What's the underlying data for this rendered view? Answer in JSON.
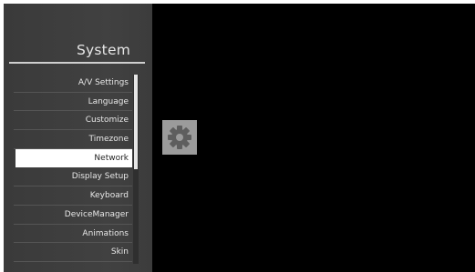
{
  "sidebar": {
    "title": "System",
    "items": [
      {
        "label": "A/V Settings"
      },
      {
        "label": "Language"
      },
      {
        "label": "Customize"
      },
      {
        "label": "Timezone"
      },
      {
        "label": "Network"
      },
      {
        "label": "Display Setup"
      },
      {
        "label": "Keyboard"
      },
      {
        "label": "DeviceManager"
      },
      {
        "label": "Animations"
      },
      {
        "label": "Skin"
      }
    ],
    "selected_label": "Network"
  },
  "preview": {
    "icon": "gear-icon"
  },
  "colors": {
    "sidebar_bg": "#3b3b3b",
    "screen_bg": "#000000",
    "selected_bg": "#ffffff",
    "gear_tile_bg": "#9b9b9b"
  }
}
